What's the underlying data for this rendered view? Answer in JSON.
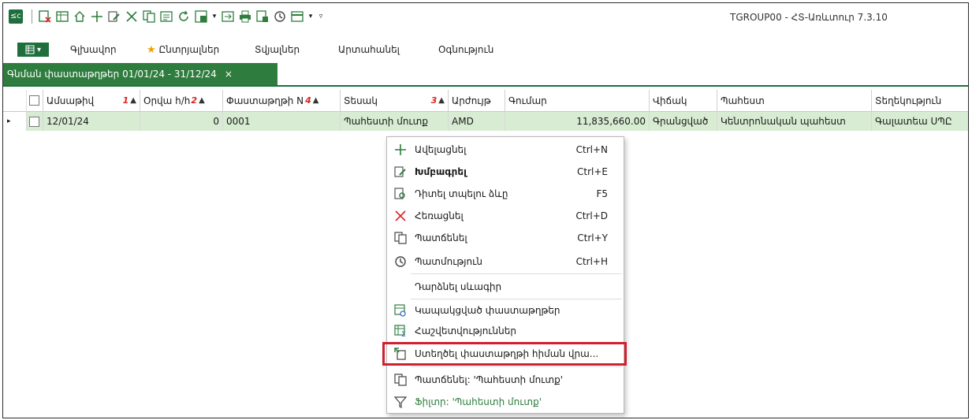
{
  "window": {
    "title": "TGROUP00 - ՀՏ-Առևտուր 7.3.10"
  },
  "menu": {
    "items": [
      "Գլխավոր",
      "Ընտրյալներ",
      "Տվյալներ",
      "Արտահանել",
      "Օգնություն"
    ]
  },
  "tab": {
    "label": "Գնման փաստաթղթեր 01/01/24 - 31/12/24",
    "close": "×"
  },
  "grid": {
    "columns": [
      {
        "label": "Ամսաթիվ",
        "sort_order": "1"
      },
      {
        "label": "Օրվա հ/հ",
        "sort_order": "2"
      },
      {
        "label": "Փաստաթղթի N",
        "sort_order": "4"
      },
      {
        "label": "Տեսակ",
        "sort_order": "3"
      },
      {
        "label": "Արժույթ",
        "sort_order": ""
      },
      {
        "label": "Գումար",
        "sort_order": ""
      },
      {
        "label": "Վիճակ",
        "sort_order": ""
      },
      {
        "label": "Պահեստ",
        "sort_order": ""
      },
      {
        "label": "Տեղեկություն",
        "sort_order": ""
      }
    ],
    "rows": [
      {
        "date": "12/01/24",
        "day_no": "0",
        "doc_no": "0001",
        "type": "Պահեստի մուտք",
        "currency": "AMD",
        "amount": "11,835,660.00",
        "status": "Գրանցված",
        "warehouse": "Կենտրոնական պահեստ",
        "info": "Գալատեա ՍՊԸ"
      }
    ]
  },
  "context_menu": {
    "items": [
      {
        "icon": "plus-icon",
        "label": "Ավելացնել",
        "shortcut": "Ctrl+N"
      },
      {
        "icon": "edit-icon",
        "label": "Խմբագրել",
        "shortcut": "Ctrl+E"
      },
      {
        "icon": "view-icon",
        "label": "Դիտել տպելու ձևը",
        "shortcut": "F5"
      },
      {
        "icon": "delete-icon",
        "label": "Հեռացնել",
        "shortcut": "Ctrl+D"
      },
      {
        "icon": "copy-icon",
        "label": "Պատճենել",
        "shortcut": "Ctrl+Y"
      },
      {
        "icon": "history-icon",
        "label": "Պատմություն",
        "shortcut": "Ctrl+H"
      },
      {
        "icon": "",
        "label": "Դարձնել սևագիր",
        "shortcut": ""
      },
      {
        "icon": "linked-docs-icon",
        "label": "Կապակցված փաստաթղթեր",
        "shortcut": ""
      },
      {
        "icon": "calculations-icon",
        "label": "Հաշվետվություններ",
        "shortcut": ""
      },
      {
        "icon": "create-from-icon",
        "label": "Ստեղծել փաստաթղթի հիման վրա...",
        "shortcut": ""
      },
      {
        "icon": "copy-value-icon",
        "label": "Պատճենել: 'Պահեստի մուտք'",
        "shortcut": ""
      },
      {
        "icon": "filter-icon",
        "label": "Ֆիլտր: 'Պահեստի մուտք'",
        "shortcut": ""
      }
    ]
  },
  "colors": {
    "accent": "#2e7d3e",
    "row_selected": "#d8ecd3",
    "highlight": "#d01f2f",
    "filter_text": "#2e7d3e"
  }
}
